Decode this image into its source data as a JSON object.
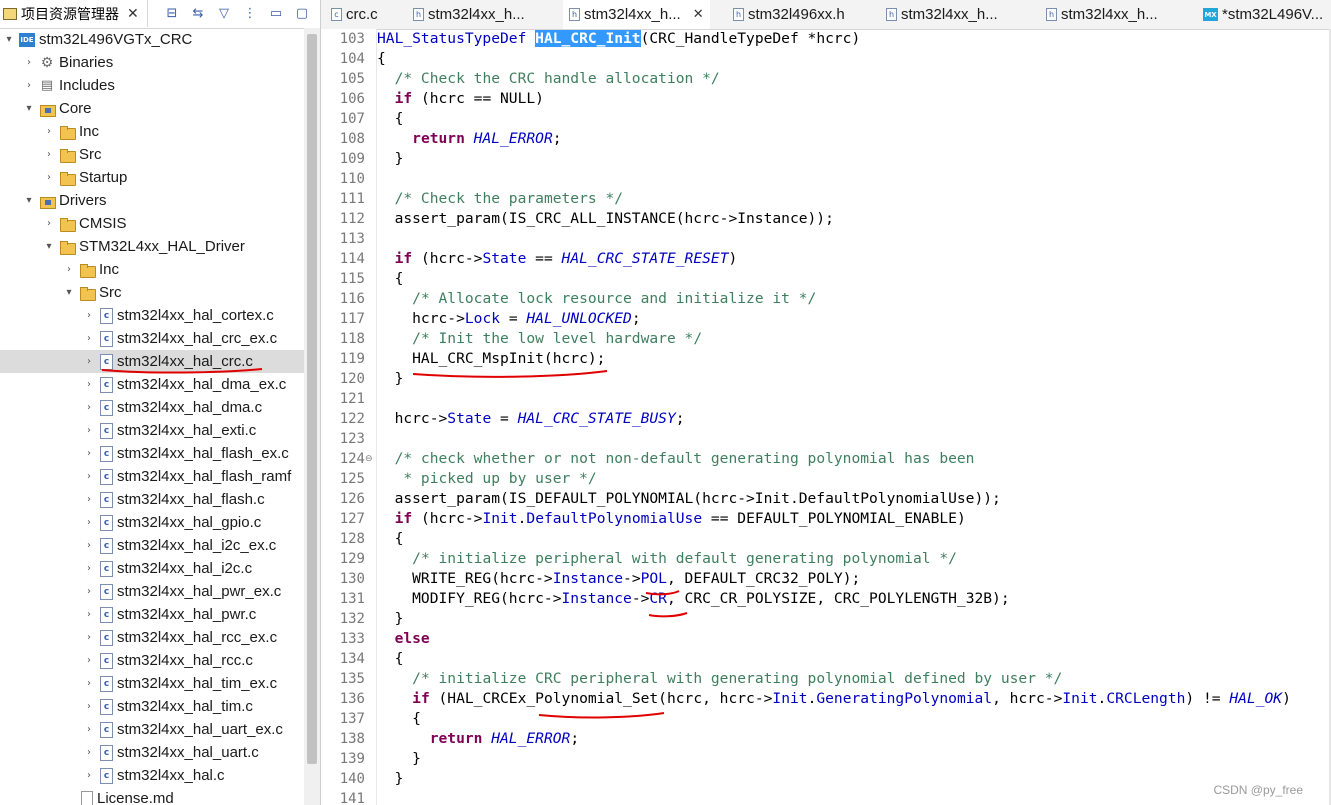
{
  "explorer": {
    "title": "项目资源管理器",
    "close": "✕",
    "tools": [
      "⊟",
      "⇆",
      "▽",
      "⋮",
      "▭",
      "▢"
    ],
    "tree": [
      {
        "label": "stm32L496VGTx_CRC",
        "icon": "ide-project-icon",
        "twisty": "▾",
        "indent": 0
      },
      {
        "label": "Binaries",
        "icon": "binaries-icon",
        "twisty": "›",
        "indent": 1
      },
      {
        "label": "Includes",
        "icon": "includes-icon",
        "twisty": "›",
        "indent": 1
      },
      {
        "label": "Core",
        "icon": "source-folder-icon",
        "twisty": "▾",
        "indent": 1
      },
      {
        "label": "Inc",
        "icon": "folder-icon",
        "twisty": "›",
        "indent": 2
      },
      {
        "label": "Src",
        "icon": "folder-icon",
        "twisty": "›",
        "indent": 2
      },
      {
        "label": "Startup",
        "icon": "folder-icon",
        "twisty": "›",
        "indent": 2
      },
      {
        "label": "Drivers",
        "icon": "source-folder-icon",
        "twisty": "▾",
        "indent": 1
      },
      {
        "label": "CMSIS",
        "icon": "folder-icon",
        "twisty": "›",
        "indent": 2
      },
      {
        "label": "STM32L4xx_HAL_Driver",
        "icon": "folder-icon",
        "twisty": "▾",
        "indent": 2
      },
      {
        "label": "Inc",
        "icon": "folder-icon",
        "twisty": "›",
        "indent": 3
      },
      {
        "label": "Src",
        "icon": "folder-icon",
        "twisty": "▾",
        "indent": 3
      },
      {
        "label": "stm32l4xx_hal_cortex.c",
        "icon": "c-file-icon",
        "twisty": "›",
        "indent": 4
      },
      {
        "label": "stm32l4xx_hal_crc_ex.c",
        "icon": "c-file-icon",
        "twisty": "›",
        "indent": 4
      },
      {
        "label": "stm32l4xx_hal_crc.c",
        "icon": "c-file-icon",
        "twisty": "›",
        "indent": 4,
        "selected": true
      },
      {
        "label": "stm32l4xx_hal_dma_ex.c",
        "icon": "c-file-icon",
        "twisty": "›",
        "indent": 4
      },
      {
        "label": "stm32l4xx_hal_dma.c",
        "icon": "c-file-icon",
        "twisty": "›",
        "indent": 4
      },
      {
        "label": "stm32l4xx_hal_exti.c",
        "icon": "c-file-icon",
        "twisty": "›",
        "indent": 4
      },
      {
        "label": "stm32l4xx_hal_flash_ex.c",
        "icon": "c-file-icon",
        "twisty": "›",
        "indent": 4
      },
      {
        "label": "stm32l4xx_hal_flash_ramf",
        "icon": "c-file-icon",
        "twisty": "›",
        "indent": 4
      },
      {
        "label": "stm32l4xx_hal_flash.c",
        "icon": "c-file-icon",
        "twisty": "›",
        "indent": 4
      },
      {
        "label": "stm32l4xx_hal_gpio.c",
        "icon": "c-file-icon",
        "twisty": "›",
        "indent": 4
      },
      {
        "label": "stm32l4xx_hal_i2c_ex.c",
        "icon": "c-file-icon",
        "twisty": "›",
        "indent": 4
      },
      {
        "label": "stm32l4xx_hal_i2c.c",
        "icon": "c-file-icon",
        "twisty": "›",
        "indent": 4
      },
      {
        "label": "stm32l4xx_hal_pwr_ex.c",
        "icon": "c-file-icon",
        "twisty": "›",
        "indent": 4
      },
      {
        "label": "stm32l4xx_hal_pwr.c",
        "icon": "c-file-icon",
        "twisty": "›",
        "indent": 4
      },
      {
        "label": "stm32l4xx_hal_rcc_ex.c",
        "icon": "c-file-icon",
        "twisty": "›",
        "indent": 4
      },
      {
        "label": "stm32l4xx_hal_rcc.c",
        "icon": "c-file-icon",
        "twisty": "›",
        "indent": 4
      },
      {
        "label": "stm32l4xx_hal_tim_ex.c",
        "icon": "c-file-icon",
        "twisty": "›",
        "indent": 4
      },
      {
        "label": "stm32l4xx_hal_tim.c",
        "icon": "c-file-icon",
        "twisty": "›",
        "indent": 4
      },
      {
        "label": "stm32l4xx_hal_uart_ex.c",
        "icon": "c-file-icon",
        "twisty": "›",
        "indent": 4
      },
      {
        "label": "stm32l4xx_hal_uart.c",
        "icon": "c-file-icon",
        "twisty": "›",
        "indent": 4
      },
      {
        "label": "stm32l4xx_hal.c",
        "icon": "c-file-icon",
        "twisty": "›",
        "indent": 4
      },
      {
        "label": "License.md",
        "icon": "document-icon",
        "twisty": "",
        "indent": 3
      }
    ]
  },
  "editor": {
    "tabs": [
      {
        "label": "crc.c",
        "icon": "c",
        "active": false
      },
      {
        "label": "stm32l4xx_h...",
        "icon": "h",
        "active": false
      },
      {
        "label": "stm32l4xx_h...",
        "icon": "h",
        "active": true,
        "close": "✕"
      },
      {
        "label": "stm32l496xx.h",
        "icon": "h",
        "active": false
      },
      {
        "label": "stm32l4xx_h...",
        "icon": "h",
        "active": false
      },
      {
        "label": "stm32l4xx_h...",
        "icon": "h",
        "active": false
      },
      {
        "label": "*stm32L496V...",
        "icon": "MX",
        "active": false
      }
    ],
    "lines": [
      {
        "n": "103",
        "fold": "",
        "segs": [
          [
            "fld",
            "HAL_StatusTypeDef "
          ],
          [
            "sel",
            "HAL_CRC_Init"
          ],
          [
            "",
            "(CRC_HandleTypeDef *hcrc)"
          ]
        ]
      },
      {
        "n": "104",
        "fold": "",
        "segs": [
          [
            "",
            "{"
          ]
        ]
      },
      {
        "n": "105",
        "fold": "",
        "segs": [
          [
            "",
            "  "
          ],
          [
            "cm",
            "/* Check the CRC handle allocation */"
          ]
        ]
      },
      {
        "n": "106",
        "fold": "",
        "segs": [
          [
            "",
            "  "
          ],
          [
            "kw",
            "if"
          ],
          [
            "",
            " (hcrc == NULL)"
          ]
        ]
      },
      {
        "n": "107",
        "fold": "",
        "segs": [
          [
            "",
            "  {"
          ]
        ]
      },
      {
        "n": "108",
        "fold": "",
        "segs": [
          [
            "",
            "    "
          ],
          [
            "kw",
            "return"
          ],
          [
            "",
            " "
          ],
          [
            "en",
            "HAL_ERROR"
          ],
          [
            "",
            ";"
          ]
        ]
      },
      {
        "n": "109",
        "fold": "",
        "segs": [
          [
            "",
            "  }"
          ]
        ]
      },
      {
        "n": "110",
        "fold": "",
        "segs": [
          [
            "",
            ""
          ]
        ]
      },
      {
        "n": "111",
        "fold": "",
        "segs": [
          [
            "",
            "  "
          ],
          [
            "cm",
            "/* Check the parameters */"
          ]
        ]
      },
      {
        "n": "112",
        "fold": "",
        "segs": [
          [
            "",
            "  assert_param(IS_CRC_ALL_INSTANCE(hcrc->Instance));"
          ]
        ]
      },
      {
        "n": "113",
        "fold": "",
        "segs": [
          [
            "",
            ""
          ]
        ]
      },
      {
        "n": "114",
        "fold": "",
        "segs": [
          [
            "",
            "  "
          ],
          [
            "kw",
            "if"
          ],
          [
            "",
            " (hcrc->"
          ],
          [
            "fld",
            "State"
          ],
          [
            "",
            " == "
          ],
          [
            "en",
            "HAL_CRC_STATE_RESET"
          ],
          [
            "",
            ")"
          ]
        ]
      },
      {
        "n": "115",
        "fold": "",
        "segs": [
          [
            "",
            "  {"
          ]
        ]
      },
      {
        "n": "116",
        "fold": "",
        "segs": [
          [
            "",
            "    "
          ],
          [
            "cm",
            "/* Allocate lock resource and initialize it */"
          ]
        ]
      },
      {
        "n": "117",
        "fold": "",
        "segs": [
          [
            "",
            "    hcrc->"
          ],
          [
            "fld",
            "Lock"
          ],
          [
            "",
            " = "
          ],
          [
            "en",
            "HAL_UNLOCKED"
          ],
          [
            "",
            ";"
          ]
        ]
      },
      {
        "n": "118",
        "fold": "",
        "segs": [
          [
            "",
            "    "
          ],
          [
            "cm",
            "/* Init the low level hardware */"
          ]
        ]
      },
      {
        "n": "119",
        "fold": "",
        "segs": [
          [
            "",
            "    HAL_CRC_MspInit(hcrc);"
          ]
        ]
      },
      {
        "n": "120",
        "fold": "",
        "segs": [
          [
            "",
            "  }"
          ]
        ]
      },
      {
        "n": "121",
        "fold": "",
        "segs": [
          [
            "",
            ""
          ]
        ]
      },
      {
        "n": "122",
        "fold": "",
        "segs": [
          [
            "",
            "  hcrc->"
          ],
          [
            "fld",
            "State"
          ],
          [
            "",
            " = "
          ],
          [
            "en",
            "HAL_CRC_STATE_BUSY"
          ],
          [
            "",
            ";"
          ]
        ]
      },
      {
        "n": "123",
        "fold": "",
        "segs": [
          [
            "",
            ""
          ]
        ]
      },
      {
        "n": "124",
        "fold": "⊖",
        "segs": [
          [
            "",
            "  "
          ],
          [
            "cm",
            "/* check whether or not non-default generating polynomial has been"
          ]
        ]
      },
      {
        "n": "125",
        "fold": "",
        "segs": [
          [
            "",
            "   "
          ],
          [
            "cm",
            "* picked up by user */"
          ]
        ]
      },
      {
        "n": "126",
        "fold": "",
        "segs": [
          [
            "",
            "  assert_param(IS_DEFAULT_POLYNOMIAL(hcrc->Init.DefaultPolynomialUse));"
          ]
        ]
      },
      {
        "n": "127",
        "fold": "",
        "segs": [
          [
            "",
            "  "
          ],
          [
            "kw",
            "if"
          ],
          [
            "",
            " (hcrc->"
          ],
          [
            "fld",
            "Init"
          ],
          [
            "",
            "."
          ],
          [
            "fld",
            "DefaultPolynomialUse"
          ],
          [
            "",
            " == DEFAULT_POLYNOMIAL_ENABLE)"
          ]
        ]
      },
      {
        "n": "128",
        "fold": "",
        "segs": [
          [
            "",
            "  {"
          ]
        ]
      },
      {
        "n": "129",
        "fold": "",
        "segs": [
          [
            "",
            "    "
          ],
          [
            "cm",
            "/* initialize peripheral with default generating polynomial */"
          ]
        ]
      },
      {
        "n": "130",
        "fold": "",
        "segs": [
          [
            "",
            "    WRITE_REG(hcrc->"
          ],
          [
            "fld",
            "Instance"
          ],
          [
            "",
            "->"
          ],
          [
            "fld",
            "POL"
          ],
          [
            "",
            ", DEFAULT_CRC32_POLY);"
          ]
        ]
      },
      {
        "n": "131",
        "fold": "",
        "segs": [
          [
            "",
            "    MODIFY_REG(hcrc->"
          ],
          [
            "fld",
            "Instance"
          ],
          [
            "",
            "->"
          ],
          [
            "fld",
            "CR"
          ],
          [
            "",
            ", CRC_CR_POLYSIZE, CRC_POLYLENGTH_32B);"
          ]
        ]
      },
      {
        "n": "132",
        "fold": "",
        "segs": [
          [
            "",
            "  }"
          ]
        ]
      },
      {
        "n": "133",
        "fold": "",
        "segs": [
          [
            "",
            "  "
          ],
          [
            "kw",
            "else"
          ]
        ]
      },
      {
        "n": "134",
        "fold": "",
        "segs": [
          [
            "",
            "  {"
          ]
        ]
      },
      {
        "n": "135",
        "fold": "",
        "segs": [
          [
            "",
            "    "
          ],
          [
            "cm",
            "/* initialize CRC peripheral with generating polynomial defined by user */"
          ]
        ]
      },
      {
        "n": "136",
        "fold": "",
        "segs": [
          [
            "",
            "    "
          ],
          [
            "kw",
            "if"
          ],
          [
            "",
            " (HAL_CRCEx_Polynomial_Set(hcrc, hcrc->"
          ],
          [
            "fld",
            "Init"
          ],
          [
            "",
            "."
          ],
          [
            "fld",
            "GeneratingPolynomial"
          ],
          [
            "",
            ", hcrc->"
          ],
          [
            "fld",
            "Init"
          ],
          [
            "",
            "."
          ],
          [
            "fld",
            "CRCLength"
          ],
          [
            "",
            ") != "
          ],
          [
            "en",
            "HAL_OK"
          ],
          [
            "",
            ")"
          ]
        ]
      },
      {
        "n": "137",
        "fold": "",
        "segs": [
          [
            "",
            "    {"
          ]
        ]
      },
      {
        "n": "138",
        "fold": "",
        "segs": [
          [
            "",
            "      "
          ],
          [
            "kw",
            "return"
          ],
          [
            "",
            " "
          ],
          [
            "en",
            "HAL_ERROR"
          ],
          [
            "",
            ";"
          ]
        ]
      },
      {
        "n": "139",
        "fold": "",
        "segs": [
          [
            "",
            "    }"
          ]
        ]
      },
      {
        "n": "140",
        "fold": "",
        "segs": [
          [
            "",
            "  }"
          ]
        ]
      },
      {
        "n": "141",
        "fold": "",
        "segs": [
          [
            "",
            ""
          ]
        ]
      }
    ]
  },
  "watermark": "CSDN @py_free",
  "colors": {
    "annotation": "#e00000",
    "selection": "#3399ff",
    "keyword": "#7f0055",
    "comment": "#3f7f5f",
    "field": "#0000c0"
  }
}
